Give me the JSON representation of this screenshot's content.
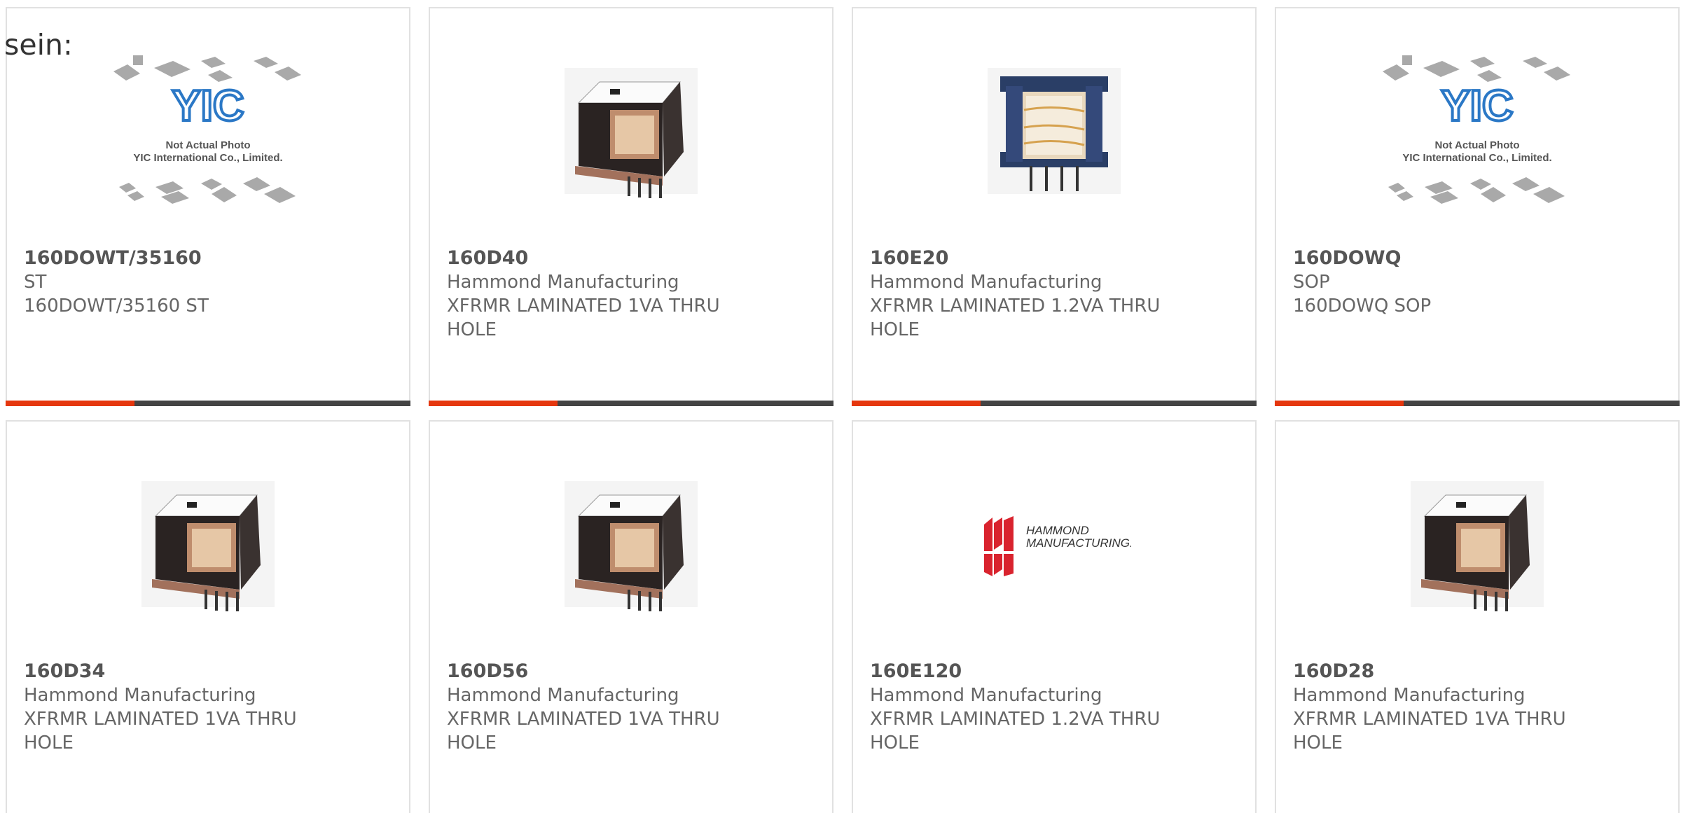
{
  "heading": "sein:",
  "colors": {
    "accent": "#e5370e",
    "bar": "#444444",
    "yic_blue": "#2b78c6",
    "hammond_red": "#d9232e"
  },
  "products": [
    {
      "part_number": "160DOWT/35160",
      "manufacturer": "ST",
      "description": "160DOWT/35160 ST",
      "image": "placeholder-photo",
      "placeholder_logo": "YIC",
      "placeholder_line1": "Not Actual Photo",
      "placeholder_line2": "YIC International Co., Limited."
    },
    {
      "part_number": "160D40",
      "manufacturer": "Hammond Manufacturing",
      "description": "XFRMR LAMINATED 1VA THRU HOLE",
      "image": "transformer-photo"
    },
    {
      "part_number": "160E20",
      "manufacturer": "Hammond Manufacturing",
      "description": "XFRMR LAMINATED 1.2VA THRU HOLE",
      "image": "transformer-photo-alt"
    },
    {
      "part_number": "160DOWQ",
      "manufacturer": "SOP",
      "description": "160DOWQ SOP",
      "image": "placeholder-photo",
      "placeholder_logo": "YIC",
      "placeholder_line1": "Not Actual Photo",
      "placeholder_line2": "YIC International Co., Limited."
    },
    {
      "part_number": "160D34",
      "manufacturer": "Hammond Manufacturing",
      "description": "XFRMR LAMINATED 1VA THRU HOLE",
      "image": "transformer-photo"
    },
    {
      "part_number": "160D56",
      "manufacturer": "Hammond Manufacturing",
      "description": "XFRMR LAMINATED 1VA THRU HOLE",
      "image": "transformer-photo"
    },
    {
      "part_number": "160E120",
      "manufacturer": "Hammond Manufacturing",
      "description": "XFRMR LAMINATED 1.2VA THRU HOLE",
      "image": "hammond-logo",
      "logo_line1": "HAMMOND",
      "logo_line2": "MANUFACTURING."
    },
    {
      "part_number": "160D28",
      "manufacturer": "Hammond Manufacturing",
      "description": "XFRMR LAMINATED 1VA THRU HOLE",
      "image": "transformer-photo"
    }
  ]
}
